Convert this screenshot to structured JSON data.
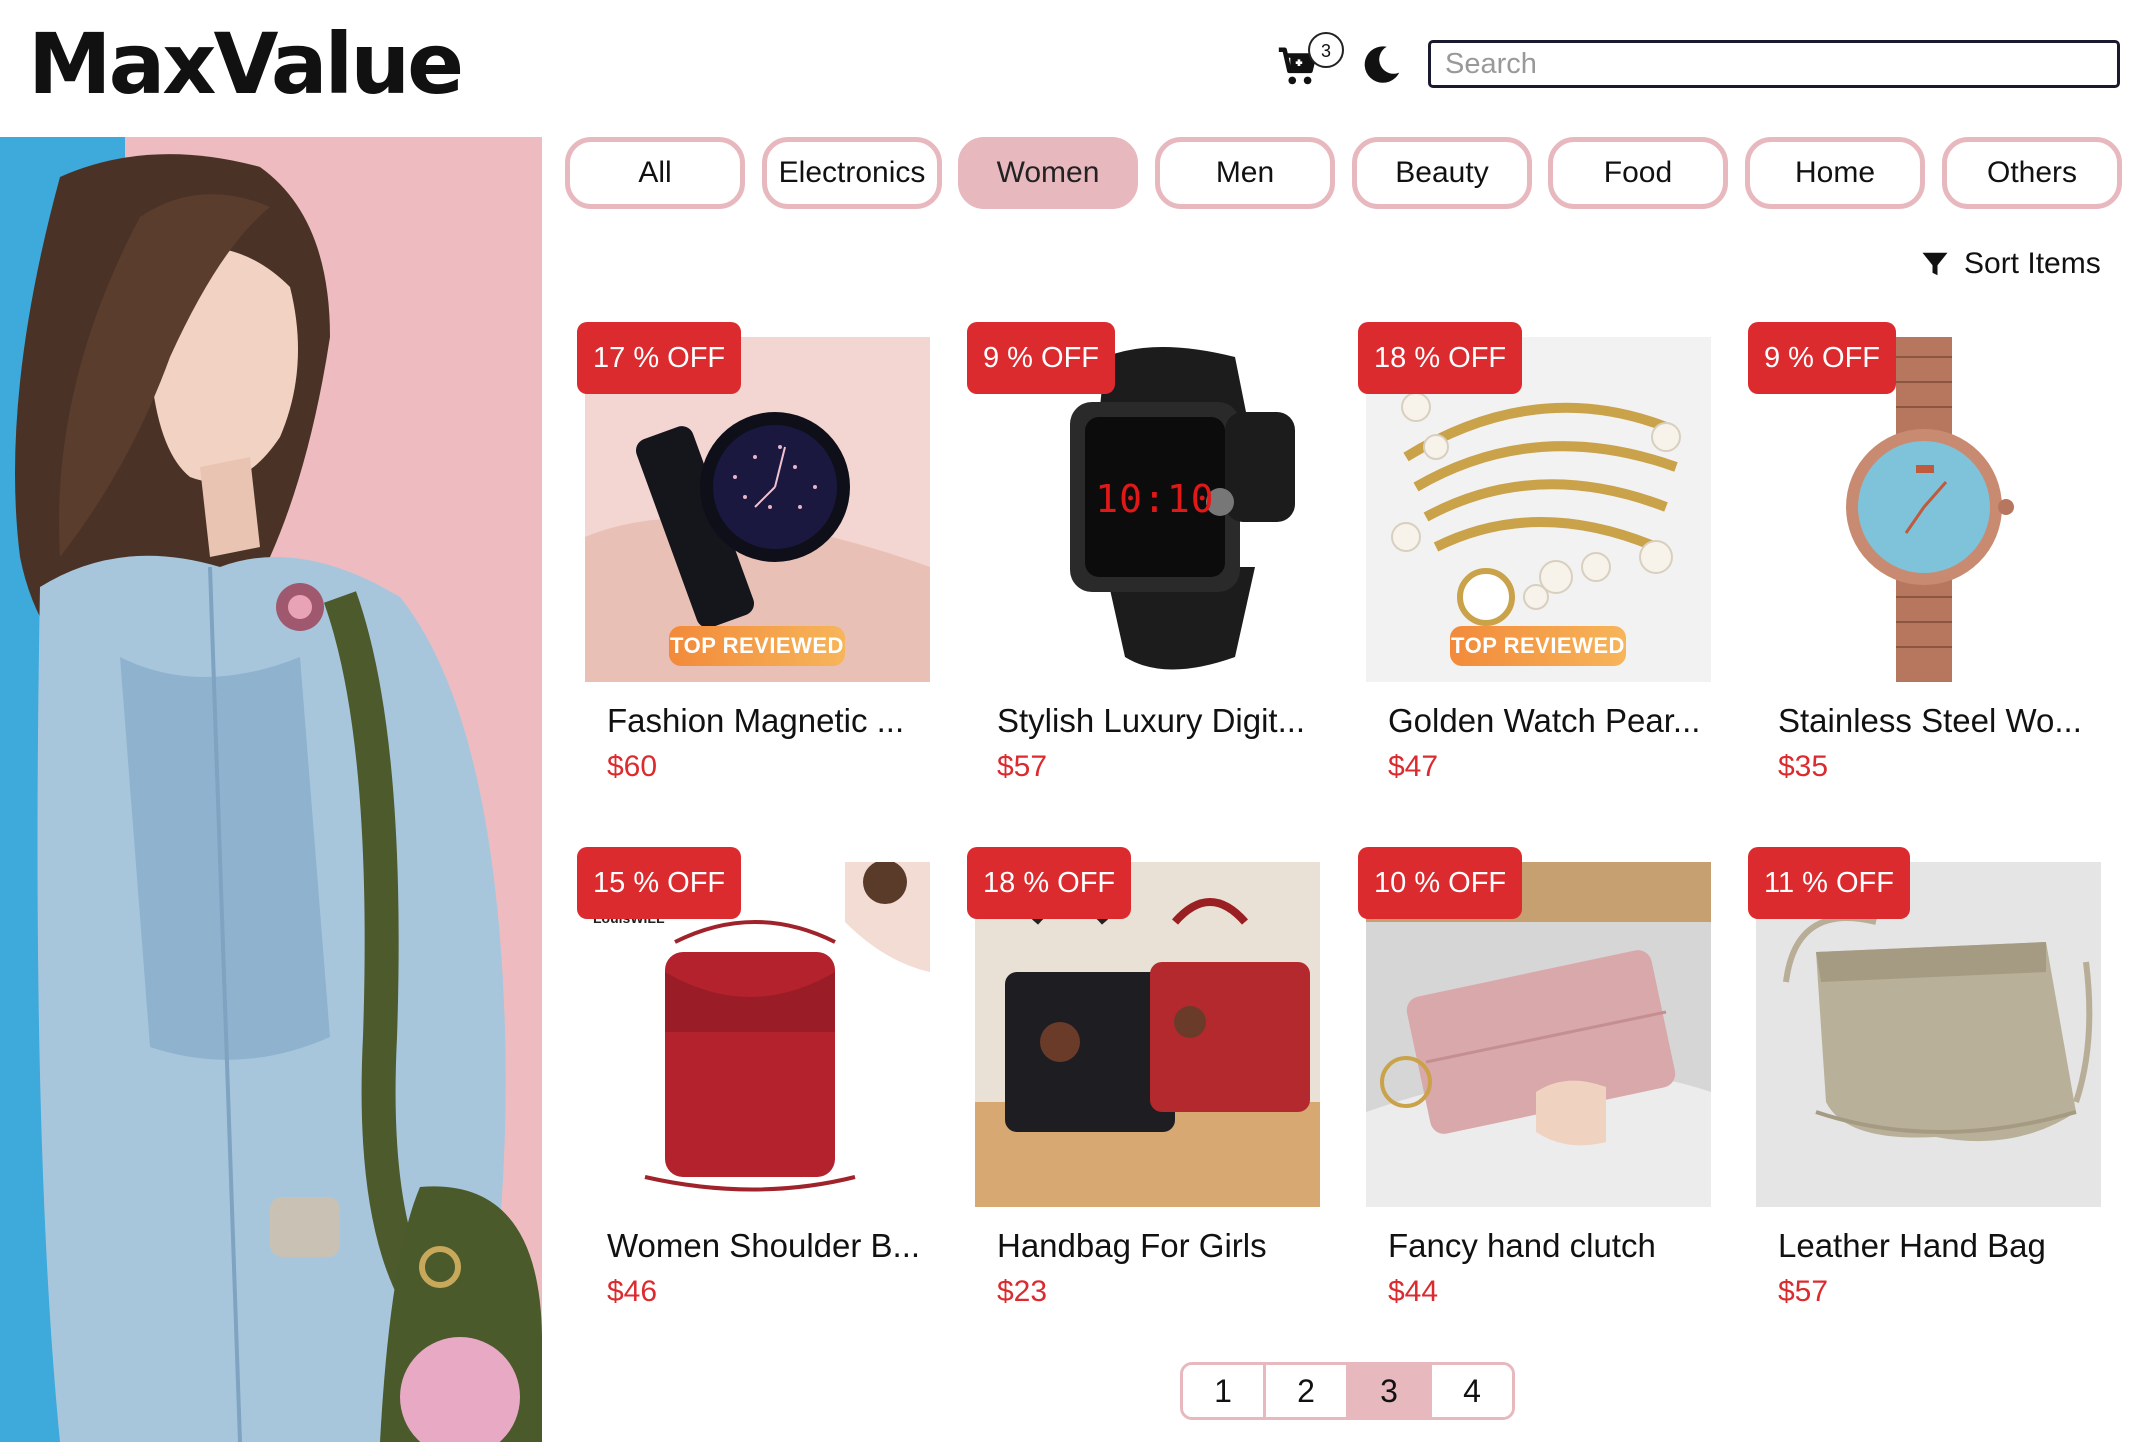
{
  "header": {
    "logo": "MaxValue",
    "cart_count": "3",
    "search_placeholder": "Search"
  },
  "categories": [
    "All",
    "Electronics",
    "Women",
    "Men",
    "Beauty",
    "Food",
    "Home",
    "Others"
  ],
  "active_category": "Women",
  "sort_label": "Sort Items",
  "products": [
    {
      "discount": "17 % OFF",
      "title": "Fashion Magnetic ...",
      "price": "$60",
      "tag": "TOP REVIEWED"
    },
    {
      "discount": "9 % OFF",
      "title": "Stylish Luxury Digit...",
      "price": "$57",
      "watch_display": "10:10"
    },
    {
      "discount": "18 % OFF",
      "title": "Golden Watch Pear...",
      "price": "$47",
      "tag": "TOP REVIEWED"
    },
    {
      "discount": "9 % OFF",
      "title": "Stainless Steel Wo...",
      "price": "$35"
    },
    {
      "discount": "15 % OFF",
      "title": "Women Shoulder B...",
      "price": "$46",
      "brand_text": "LouisWILL"
    },
    {
      "discount": "18 % OFF",
      "title": "Handbag For Girls",
      "price": "$23"
    },
    {
      "discount": "10 % OFF",
      "title": "Fancy hand clutch",
      "price": "$44"
    },
    {
      "discount": "11 % OFF",
      "title": "Leather Hand Bag",
      "price": "$57"
    }
  ],
  "pagination": {
    "pages": [
      "1",
      "2",
      "3",
      "4"
    ],
    "current": "3"
  },
  "colors": {
    "accent_pink": "#e8b8bf",
    "discount_red": "#dc2b2f",
    "text_dark": "#111111"
  },
  "icons": [
    "cart-icon",
    "moon-icon",
    "filter-icon"
  ]
}
